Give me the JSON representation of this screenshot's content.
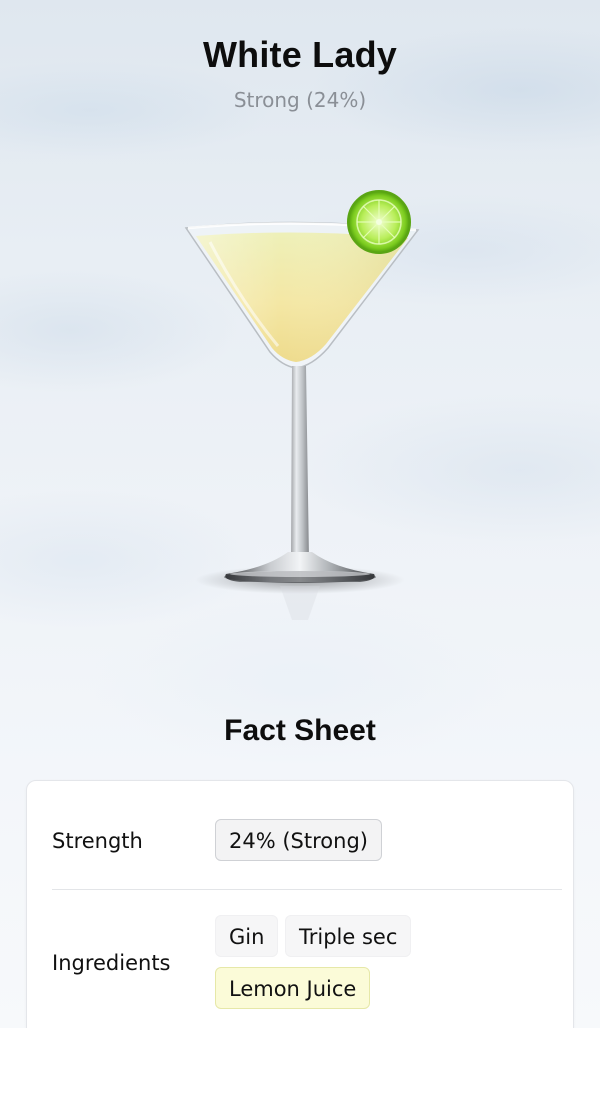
{
  "drink": {
    "name": "White Lady",
    "strength_subtitle": "Strong (24%)",
    "image": "martini-glass-with-lime-image"
  },
  "fact_sheet": {
    "title": "Fact Sheet",
    "strength": {
      "label": "Strength",
      "value": "24% (Strong)"
    },
    "ingredients": {
      "label": "Ingredients",
      "items": [
        {
          "name": "Gin",
          "highlighted": false
        },
        {
          "name": "Triple sec",
          "highlighted": false
        },
        {
          "name": "Lemon Juice",
          "highlighted": true
        }
      ]
    }
  },
  "colors": {
    "highlight_chip": "#fbfbd8",
    "subtitle_text": "#8a8f96",
    "liquid": "#f4e9a0",
    "lime": "#8fd12e"
  }
}
